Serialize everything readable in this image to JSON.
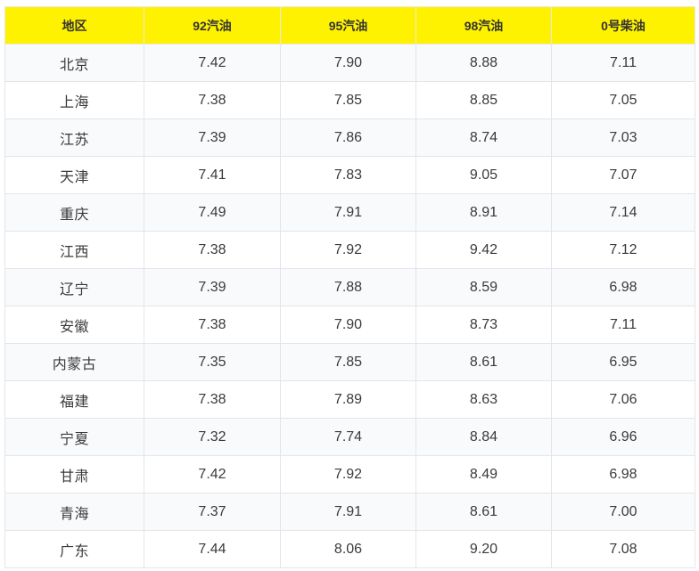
{
  "table": {
    "headers": [
      "地区",
      "92汽油",
      "95汽油",
      "98汽油",
      "0号柴油"
    ],
    "rows": [
      [
        "北京",
        "7.42",
        "7.90",
        "8.88",
        "7.11"
      ],
      [
        "上海",
        "7.38",
        "7.85",
        "8.85",
        "7.05"
      ],
      [
        "江苏",
        "7.39",
        "7.86",
        "8.74",
        "7.03"
      ],
      [
        "天津",
        "7.41",
        "7.83",
        "9.05",
        "7.07"
      ],
      [
        "重庆",
        "7.49",
        "7.91",
        "8.91",
        "7.14"
      ],
      [
        "江西",
        "7.38",
        "7.92",
        "9.42",
        "7.12"
      ],
      [
        "辽宁",
        "7.39",
        "7.88",
        "8.59",
        "6.98"
      ],
      [
        "安徽",
        "7.38",
        "7.90",
        "8.73",
        "7.11"
      ],
      [
        "内蒙古",
        "7.35",
        "7.85",
        "8.61",
        "6.95"
      ],
      [
        "福建",
        "7.38",
        "7.89",
        "8.63",
        "7.06"
      ],
      [
        "宁夏",
        "7.32",
        "7.74",
        "8.84",
        "6.96"
      ],
      [
        "甘肃",
        "7.42",
        "7.92",
        "8.49",
        "6.98"
      ],
      [
        "青海",
        "7.37",
        "7.91",
        "8.61",
        "7.00"
      ],
      [
        "广东",
        "7.44",
        "8.06",
        "9.20",
        "7.08"
      ]
    ]
  },
  "colors": {
    "header_background": "#fff200",
    "row_stripe": "#f8fafc",
    "border": "#e2e6ea"
  }
}
